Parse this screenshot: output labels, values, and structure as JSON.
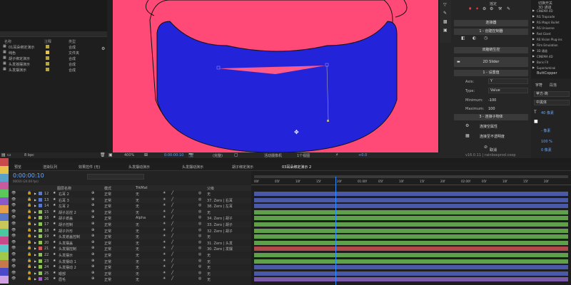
{
  "project": {
    "search_placeholder": "",
    "headers": [
      "名称",
      "注释",
      "类型"
    ],
    "items": [
      {
        "name": "01耳朵绑定演示",
        "color": "#b5a642",
        "type": "合成"
      },
      {
        "name": "纯色",
        "color": "#e6c24a",
        "type": "文件夹"
      },
      {
        "name": "胡子绑定演示",
        "color": "#b5a642",
        "type": "合成"
      },
      {
        "name": "头发摇摆演示",
        "color": "#b5a642",
        "type": "合成"
      },
      {
        "name": "头发摆演示",
        "color": "#b5a642",
        "type": "合成"
      }
    ],
    "bpc": "8 bpc"
  },
  "viewer": {
    "zoom": "400%",
    "timecode": "0:00:00:10",
    "resolution": "(完整)",
    "camera": "活动摄像机",
    "views": "1个视图",
    "exposure": "+0.0"
  },
  "colors": {
    "canvas_bg": "#ff4a78",
    "blue": "#2323d9",
    "accent": "#2b8cff",
    "green_bar": "#5fa04a",
    "blue_bar": "#4a5aa8",
    "red_bar": "#b04a4a",
    "purple_bar": "#7a5aa8"
  },
  "duik": {
    "header": "摇定",
    "tools": [
      "连接器",
      "1 - 创建控制器",
      "双脑链生控",
      "2D Slider",
      "1 - 设置值"
    ],
    "axis_label": "Axis:",
    "axis_value": "Y",
    "type_label": "Type:",
    "type_value": "Value",
    "min_label": "Minimum:",
    "min_value": "-100",
    "max_label": "Maximum:",
    "max_value": "100",
    "step3": "3 - 连接子物体",
    "connect_prop": "连接空属性",
    "connect_opacity": "连接至不透明度",
    "cancel": "取消",
    "version": "v16.0.11 | rainboxprod.coop"
  },
  "effects": {
    "items": [
      "CINEMA 4D",
      "RG Trapcode",
      "RG Magic Bullet",
      "RG Universe",
      "Red Giant",
      "RE:Vision Plug-ins",
      "Film Emulation",
      "3D 通道",
      "CINEMA 4D",
      "Boris FX",
      "Superluminal"
    ],
    "selected": [
      "切换开关",
      "3D 通道"
    ]
  },
  "character": {
    "title": "字符",
    "tab2": "段落",
    "font": "苹方-简",
    "style": "中黑体",
    "size": "40 像素",
    "leading": "- 像素",
    "scale": "100 %",
    "baseline": "0 像素",
    "extra": "ButtCopper"
  },
  "tabs": [
    "预览",
    "渲染队列",
    "效果控件 (无)",
    "头发摆动演示",
    "头发摆动演示",
    "胡子绑定演示",
    "03耳朵绑定演示 2"
  ],
  "timeline": {
    "timecode": "0:00:00:10",
    "frame": "00010 (24.00 fps)",
    "col_headers": [
      "图层名称",
      "模式",
      "TrkMat",
      "父级"
    ],
    "ruler": [
      "00f",
      "05f",
      "10f",
      "15f",
      "20f",
      "01:00f",
      "05f",
      "10f",
      "15f",
      "20f",
      "02:00f",
      "05f",
      "10f",
      "15f",
      "20f"
    ],
    "layers": [
      {
        "num": "12",
        "name": "右耳 2",
        "color": "#5a78c8",
        "mode": "正常",
        "trk": "无",
        "parent": "无",
        "bar": "blue"
      },
      {
        "num": "13",
        "name": "右耳 3",
        "color": "#5a78c8",
        "mode": "正常",
        "trk": "无",
        "parent": "37. Zero | 右耳",
        "bar": "blue"
      },
      {
        "num": "14",
        "name": "左耳 2",
        "color": "#5a78c8",
        "mode": "正常",
        "trk": "无",
        "parent": "38. Zero | 左耳",
        "bar": "blue"
      },
      {
        "num": "15",
        "name": "胡子总控 2",
        "color": "#8fbf5a",
        "mode": "正常",
        "trk": "无",
        "parent": "无",
        "bar": "green"
      },
      {
        "num": "16",
        "name": "胡子遮盖",
        "color": "#8fbf5a",
        "mode": "正常",
        "trk": "Alpha",
        "parent": "34. Zero | 胡子",
        "bar": "green"
      },
      {
        "num": "17",
        "name": "胡子控制",
        "color": "#8fbf5a",
        "mode": "正常",
        "trk": "无",
        "parent": "33. Zero | 胡子",
        "bar": "green"
      },
      {
        "num": "18",
        "name": "胡子外形",
        "color": "#8fbf5a",
        "mode": "正常",
        "trk": "无",
        "parent": "32. Zero | 胡子",
        "bar": "green"
      },
      {
        "num": "19",
        "name": "头发遮盖控制",
        "color": "#8fbf5a",
        "mode": "正常",
        "trk": "无",
        "parent": "无",
        "bar": "green"
      },
      {
        "num": "20",
        "name": "头发摆盖",
        "color": "#8fbf5a",
        "mode": "正常",
        "trk": "无",
        "parent": "31. Zero | 头发",
        "bar": "green"
      },
      {
        "num": "21",
        "name": "头发摆控制",
        "color": "#c85a5a",
        "mode": "正常",
        "trk": "无",
        "parent": "30. Zero | 发摆",
        "bar": "red"
      },
      {
        "num": "22",
        "name": "头发摆示",
        "color": "#8fbf5a",
        "mode": "正常",
        "trk": "无",
        "parent": "无",
        "bar": "green"
      },
      {
        "num": "23",
        "name": "头发摆动 1",
        "color": "#8fbf5a",
        "mode": "正常",
        "trk": "无",
        "parent": "无",
        "bar": "green"
      },
      {
        "num": "24",
        "name": "头发摆动 2",
        "color": "#8fbf5a",
        "mode": "正常",
        "trk": "无",
        "parent": "无",
        "bar": "blue"
      },
      {
        "num": "25",
        "name": "眼部",
        "color": "#8fbf5a",
        "mode": "正常",
        "trk": "无",
        "parent": "无",
        "bar": "blue"
      },
      {
        "num": "26",
        "name": "眉毛",
        "color": "#a05ac8",
        "mode": "正常",
        "trk": "无",
        "parent": "无",
        "bar": "purple"
      }
    ]
  },
  "label_colors": [
    "#c84a4a",
    "#e6c24a",
    "#5aa0c8",
    "#c85aa0",
    "#5ac85a",
    "#8a5ac8",
    "#e6a04a",
    "#5a78c8",
    "#c8c85a",
    "#4ac8a0",
    "#c84a8a",
    "#5ac8c8",
    "#a0c84a",
    "#c8784a",
    "#4a4ac8",
    "#d0a0e0"
  ],
  "playhead_pos": 0.26
}
